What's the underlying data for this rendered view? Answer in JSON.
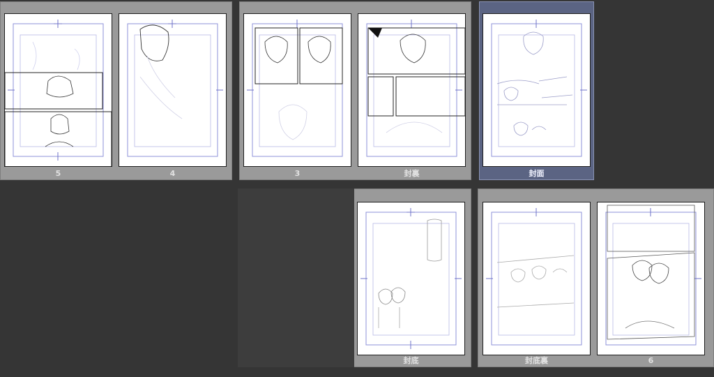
{
  "spreads": [
    {
      "pages": [
        {
          "label": "5"
        },
        {
          "label": "4"
        }
      ]
    },
    {
      "pages": [
        {
          "label": "3"
        },
        {
          "label": "封裏"
        }
      ]
    },
    {
      "pages": [
        {
          "label": "封面"
        }
      ]
    },
    {
      "pages": [
        {
          "label": "封底"
        }
      ]
    },
    {
      "pages": [
        {
          "label": "封底裏"
        },
        {
          "label": "6"
        }
      ]
    }
  ],
  "colors": {
    "background": "#353535",
    "spread": "#9a9a9a",
    "selected_spread": "#5b6483",
    "guide": "#6f73c9"
  }
}
